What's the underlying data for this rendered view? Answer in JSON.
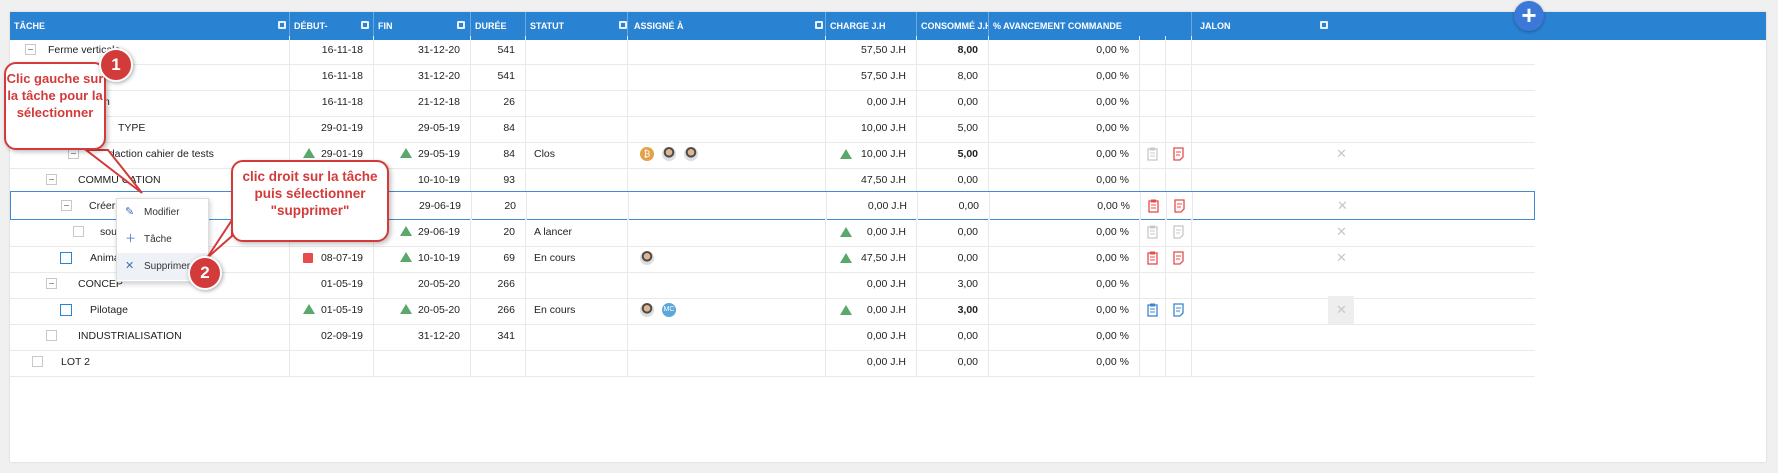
{
  "header": {
    "columns": [
      "TÂCHE",
      "DÉBUT-",
      "FIN",
      "DURÉE",
      "STATUT",
      "ASSIGNÉ À",
      "CHARGE J.H",
      "CONSOMMÉ J.H",
      "% AVANCEMENT COMMANDE",
      "JALON"
    ],
    "add_button": "+"
  },
  "rows": [
    {
      "name": "Ferme verticale",
      "start": "16-11-18",
      "end": "31-12-20",
      "duration": "541",
      "status": "",
      "charge": "57,50 J.H",
      "consumed": "8,00",
      "progress": "0,00 %"
    },
    {
      "name": "",
      "start": "16-11-18",
      "end": "31-12-20",
      "duration": "541",
      "status": "",
      "charge": "57,50 J.H",
      "consumed": "8,00",
      "progress": "0,00 %"
    },
    {
      "name": "n",
      "start": "16-11-18",
      "end": "21-12-18",
      "duration": "26",
      "status": "",
      "charge": "0,00 J.H",
      "consumed": "0,00",
      "progress": "0,00 %"
    },
    {
      "name": "TYPE",
      "start": "29-01-19",
      "end": "29-05-19",
      "duration": "84",
      "status": "",
      "charge": "10,00 J.H",
      "consumed": "5,00",
      "progress": "0,00 %"
    },
    {
      "name": "édaction cahier de tests",
      "start": "29-01-19",
      "end": "29-05-19",
      "duration": "84",
      "status": "Clos",
      "charge": "10,00 J.H",
      "consumed": "5,00",
      "progress": "0,00 %"
    },
    {
      "name": "COMMU      CATION",
      "start": "",
      "end": "10-10-19",
      "duration": "93",
      "status": "",
      "charge": "47,50 J.H",
      "consumed": "0,00",
      "progress": "0,00 %"
    },
    {
      "name": "Créer p",
      "start": "",
      "end": "29-06-19",
      "duration": "20",
      "status": "",
      "charge": "0,00 J.H",
      "consumed": "0,00",
      "progress": "0,00 %"
    },
    {
      "name": "sous",
      "start": "",
      "end": "29-06-19",
      "duration": "20",
      "status": "A lancer",
      "charge": "0,00 J.H",
      "consumed": "0,00",
      "progress": "0,00 %"
    },
    {
      "name": "Anima",
      "start": "08-07-19",
      "end": "10-10-19",
      "duration": "69",
      "status": "En cours",
      "charge": "47,50 J.H",
      "consumed": "0,00",
      "progress": "0,00 %"
    },
    {
      "name": "CONCEP",
      "start": "01-05-19",
      "end": "20-05-20",
      "duration": "266",
      "status": "",
      "charge": "0,00 J.H",
      "consumed": "3,00",
      "progress": "0,00 %"
    },
    {
      "name": "Pilotage",
      "start": "01-05-19",
      "end": "20-05-20",
      "duration": "266",
      "status": "En cours",
      "charge": "0,00 J.H",
      "consumed": "3,00",
      "progress": "0,00 %"
    },
    {
      "name": "INDUSTRIALISATION",
      "start": "02-09-19",
      "end": "31-12-20",
      "duration": "341",
      "status": "",
      "charge": "0,00 J.H",
      "consumed": "0,00",
      "progress": "0,00 %"
    },
    {
      "name": "LOT 2",
      "start": "",
      "end": "",
      "duration": "",
      "status": "",
      "charge": "0,00 J.H",
      "consumed": "0,00",
      "progress": "0,00 %"
    }
  ],
  "avatars": {
    "bitcoin_initial": "₿",
    "mc_initials": "MC"
  },
  "context_menu": {
    "items": [
      "Modifier",
      "Tâche",
      "Supprimer"
    ]
  },
  "callouts": {
    "one": {
      "number": "1",
      "text": "Clic gauche sur la tâche pour la sélectionner"
    },
    "two": {
      "number": "2",
      "text": "clic droit sur la tâche puis sélectionner \"supprimer\""
    }
  },
  "colors": {
    "header": "#2a82d2",
    "callout": "#d33a3a",
    "triangle": "#5aa86a",
    "square": "#e64c4c"
  }
}
